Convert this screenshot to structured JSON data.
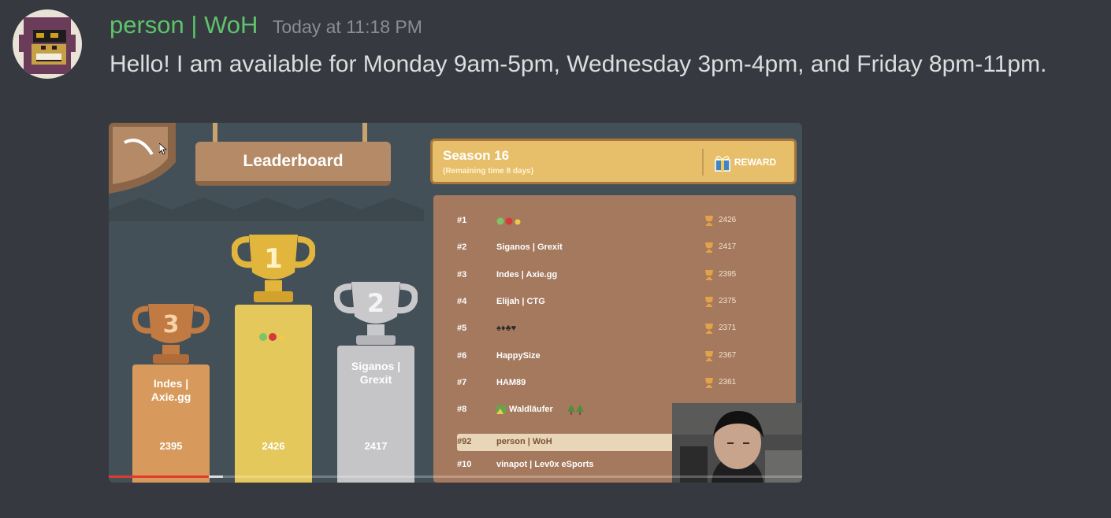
{
  "message": {
    "username": "person | WoH",
    "timestamp": "Today at 11:18 PM",
    "text": "Hello! I am available for Monday 9am-5pm, Wednesday 3pm-4pm, and Friday 8pm-11pm.",
    "colors": {
      "username": "#5ec46c",
      "background": "#36393f",
      "text": "#dcddde"
    }
  },
  "embed": {
    "board_title": "Leaderboard",
    "season_title": "Season 16",
    "season_subtitle": "(Remaining time 8 days)",
    "reward_label": "REWARD",
    "podium": [
      {
        "place": "3",
        "name": "Indes | Axie.gg",
        "score": "2395"
      },
      {
        "place": "1",
        "name": "",
        "score": "2426"
      },
      {
        "place": "2",
        "name": "Siganos | Grexit",
        "score": "2417"
      }
    ],
    "rows": [
      {
        "rank": "#1",
        "name": "",
        "score": "2426"
      },
      {
        "rank": "#2",
        "name": "Siganos | Grexit",
        "score": "2417"
      },
      {
        "rank": "#3",
        "name": "Indes | Axie.gg",
        "score": "2395"
      },
      {
        "rank": "#4",
        "name": "Elijah | CTG",
        "score": "2375"
      },
      {
        "rank": "#5",
        "name": "♠♦♣♥",
        "score": "2371"
      },
      {
        "rank": "#6",
        "name": "HappySize",
        "score": "2367"
      },
      {
        "rank": "#7",
        "name": "HAM89",
        "score": "2361"
      },
      {
        "rank": "#8",
        "name": "Waldläufer",
        "score": ""
      },
      {
        "rank": "#92",
        "name": "person | WoH",
        "score": ""
      },
      {
        "rank": "#10",
        "name": "vinapot | Lev0x eSports",
        "score": ""
      }
    ],
    "video_progress": 0.144
  }
}
